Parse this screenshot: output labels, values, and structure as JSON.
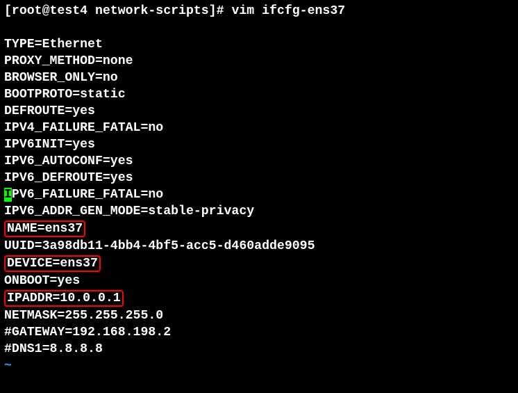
{
  "prompt": "[root@test4 network-scripts]# ",
  "command": "vim ifcfg-ens37",
  "lines": {
    "type": "TYPE=Ethernet",
    "proxy_method": "PROXY_METHOD=none",
    "browser_only": "BROWSER_ONLY=no",
    "bootproto": "BOOTPROTO=static",
    "defroute": "DEFROUTE=yes",
    "ipv4_failure_fatal": "IPV4_FAILURE_FATAL=no",
    "ipv6init": "IPV6INIT=yes",
    "ipv6_autoconf": "IPV6_AUTOCONF=yes",
    "ipv6_defroute": "IPV6_DEFROUTE=yes",
    "ipv6_failure_fatal_first": "I",
    "ipv6_failure_fatal_rest": "PV6_FAILURE_FATAL=no",
    "ipv6_addr_gen_mode": "IPV6_ADDR_GEN_MODE=stable-privacy",
    "name": "NAME=ens37",
    "uuid": "UUID=3a98db11-4bb4-4bf5-acc5-d460adde9095",
    "device": "DEVICE=ens37",
    "onboot": "ONBOOT=yes",
    "ipaddr": "IPADDR=10.0.0.1",
    "netmask": "NETMASK=255.255.255.0",
    "gateway": "#GATEWAY=192.168.198.2",
    "dns1": "#DNS1=8.8.8.8"
  },
  "tilde": "~"
}
